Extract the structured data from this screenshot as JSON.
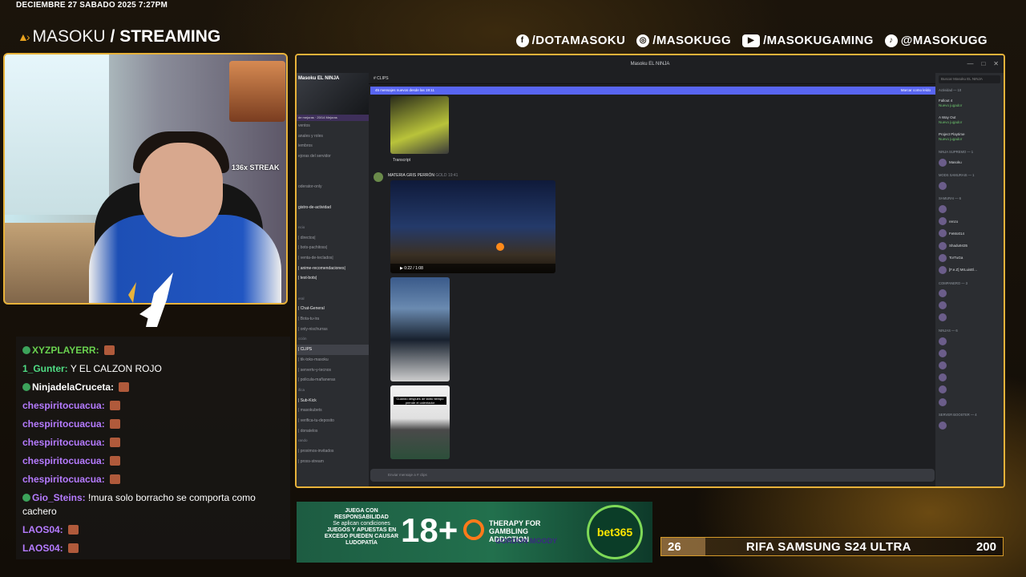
{
  "header": {
    "datetime": "DECIEMBRE 27 SABADO 2025 7:27PM",
    "brand_light": "MASOKU",
    "brand_bold": "/ STREAMING"
  },
  "socials": [
    {
      "icon": "facebook-icon",
      "label": "/DOTAMASOKU"
    },
    {
      "icon": "instagram-icon",
      "label": "/MASOKUGG"
    },
    {
      "icon": "youtube-icon",
      "label": "/MASOKUGAMING"
    },
    {
      "icon": "tiktok-icon",
      "label": "@MASOKUGG"
    }
  ],
  "webcam": {
    "streak_label": "136x STREAK"
  },
  "chat": [
    {
      "user": "XYZPLAYERR:",
      "text": "",
      "color": "#69d14f",
      "badge": true
    },
    {
      "user": "1_Gunter:",
      "text": "Y EL CALZON ROJO",
      "color": "#4fdc84",
      "badge": false
    },
    {
      "user": "NinjadelaCruceta:",
      "text": "",
      "color": "#ffffff",
      "badge": true
    },
    {
      "user": "chespiritocuacua:",
      "text": "",
      "color": "#b57bff",
      "badge": false
    },
    {
      "user": "chespiritocuacua:",
      "text": "",
      "color": "#b57bff",
      "badge": false
    },
    {
      "user": "chespiritocuacua:",
      "text": "",
      "color": "#b57bff",
      "badge": false
    },
    {
      "user": "chespiritocuacua:",
      "text": "",
      "color": "#b57bff",
      "badge": false
    },
    {
      "user": "chespiritocuacua:",
      "text": "",
      "color": "#b57bff",
      "badge": false
    },
    {
      "user": "Gio_Steins:",
      "text": "!mura solo borracho se comporta como cachero",
      "color": "#b57bff",
      "badge": true
    },
    {
      "user": "LAOS04:",
      "text": "",
      "color": "#b57bff",
      "badge": false
    },
    {
      "user": "LAOS04:",
      "text": "",
      "color": "#b57bff",
      "badge": false
    }
  ],
  "discord": {
    "window_title": "Masoku EL NINJA",
    "server_name": "Masoku EL NINJA",
    "boost_label": "de mejoras",
    "boost_count": "20/14 Mejoras",
    "channels": [
      {
        "label": "ventos",
        "kind": "ch"
      },
      {
        "label": "anales y roles",
        "kind": "ch"
      },
      {
        "label": "iembros",
        "kind": "ch"
      },
      {
        "label": "ejoras del servidor",
        "kind": "ch"
      },
      {
        "label": "",
        "kind": "ch"
      },
      {
        "label": "",
        "kind": "ch"
      },
      {
        "label": "oderator-only",
        "kind": "ch"
      },
      {
        "label": "",
        "kind": "ch"
      },
      {
        "label": "gistro-de-actividad",
        "kind": "bright"
      },
      {
        "label": "",
        "kind": "ch"
      },
      {
        "label": "ncio",
        "kind": "hd"
      },
      {
        "label": "| directos|",
        "kind": "ch"
      },
      {
        "label": "| bots-pachitoss|",
        "kind": "ch"
      },
      {
        "label": "| venta-de-teclados|",
        "kind": "ch"
      },
      {
        "label": "| anime-recomendaciones|",
        "kind": "bright"
      },
      {
        "label": "| test-bots|",
        "kind": "bright"
      },
      {
        "label": "",
        "kind": "ch"
      },
      {
        "label": "eral",
        "kind": "hd"
      },
      {
        "label": "| Chat-General",
        "kind": "bright"
      },
      {
        "label": "| Bota-tu-ira",
        "kind": "ch"
      },
      {
        "label": "| only-nischurras",
        "kind": "ch"
      },
      {
        "label": "cción",
        "kind": "hd"
      },
      {
        "label": "| CLIPS",
        "kind": "act"
      },
      {
        "label": "| tik-toks-masoku",
        "kind": "ch"
      },
      {
        "label": "| servertv-y-tecnos",
        "kind": "ch"
      },
      {
        "label": "| policula-mañaneras",
        "kind": "ch"
      },
      {
        "label": "ifica",
        "kind": "hd"
      },
      {
        "label": "| Sub-Kick",
        "kind": "bright"
      },
      {
        "label": "| masokubets",
        "kind": "ch"
      },
      {
        "label": "| verifica-tu-deposito",
        "kind": "ch"
      },
      {
        "label": "| donatelos",
        "kind": "ch"
      },
      {
        "label": "rando",
        "kind": "hd"
      },
      {
        "label": "| proximos-invitados",
        "kind": "ch"
      },
      {
        "label": "| proxs-stream",
        "kind": "ch"
      }
    ],
    "channel_header": "CLIPS",
    "new_messages": "45 mensajes nuevos desde las 19:11",
    "mark_read": "Marcar como leído",
    "transcript": "Transcript",
    "author": "MATERIA GRIS PERRÓN",
    "author_tag": "GOLD",
    "author_time": "19:41",
    "video_time": "0:22 / 1:08",
    "overlay_text": "Cuando después de tanto tiempo prende el calentador",
    "input_placeholder": "Enviar mensaje a # clips",
    "members": {
      "search": "Buscar Masoku EL NINJA",
      "activity": "Actividad — 10",
      "games": [
        {
          "name": "Fallout 4",
          "sub": "Nuevo jugador"
        },
        {
          "name": "A Way Out",
          "sub": "Nuevo jugador"
        },
        {
          "name": "Project Playtime",
          "sub": "Nuevo jugador"
        }
      ],
      "groups": [
        {
          "title": "NINJA SUPREMO — 1",
          "items": [
            "Masoku"
          ]
        },
        {
          "title": "MODS SAMURAIS — 1",
          "items": [
            ""
          ]
        },
        {
          "title": "SAMURAI — 6",
          "items": [
            "",
            "renzo",
            "FeMo014",
            "Shadu9435",
            "TorTuGa",
            "[F.e.Z] MrLuisEl..."
          ]
        },
        {
          "title": "COMPANERO — 3",
          "items": [
            "",
            "",
            ""
          ]
        },
        {
          "title": "NINJAS — 6",
          "items": [
            "",
            "",
            "",
            "",
            "",
            ""
          ]
        },
        {
          "title": "SERVER BOOSTER — 4",
          "items": [
            ""
          ]
        }
      ]
    }
  },
  "ad": {
    "line1": "JUEGA CON RESPONSABILIDAD",
    "line2": "Se aplican condiciones",
    "line3": "JUEGOS Y APUESTAS EN EXCESO PUEDEN CAUSAR LUDOPATÍA",
    "age": "18+",
    "therapy": "THERAPY FOR GAMBLING ADDICTION",
    "gordon": "GORDON MOODY",
    "bet": "bet365"
  },
  "raffle": {
    "current": "26",
    "title": "RIFA SAMSUNG S24 ULTRA",
    "goal": "200",
    "progress_fraction": 0.13
  }
}
